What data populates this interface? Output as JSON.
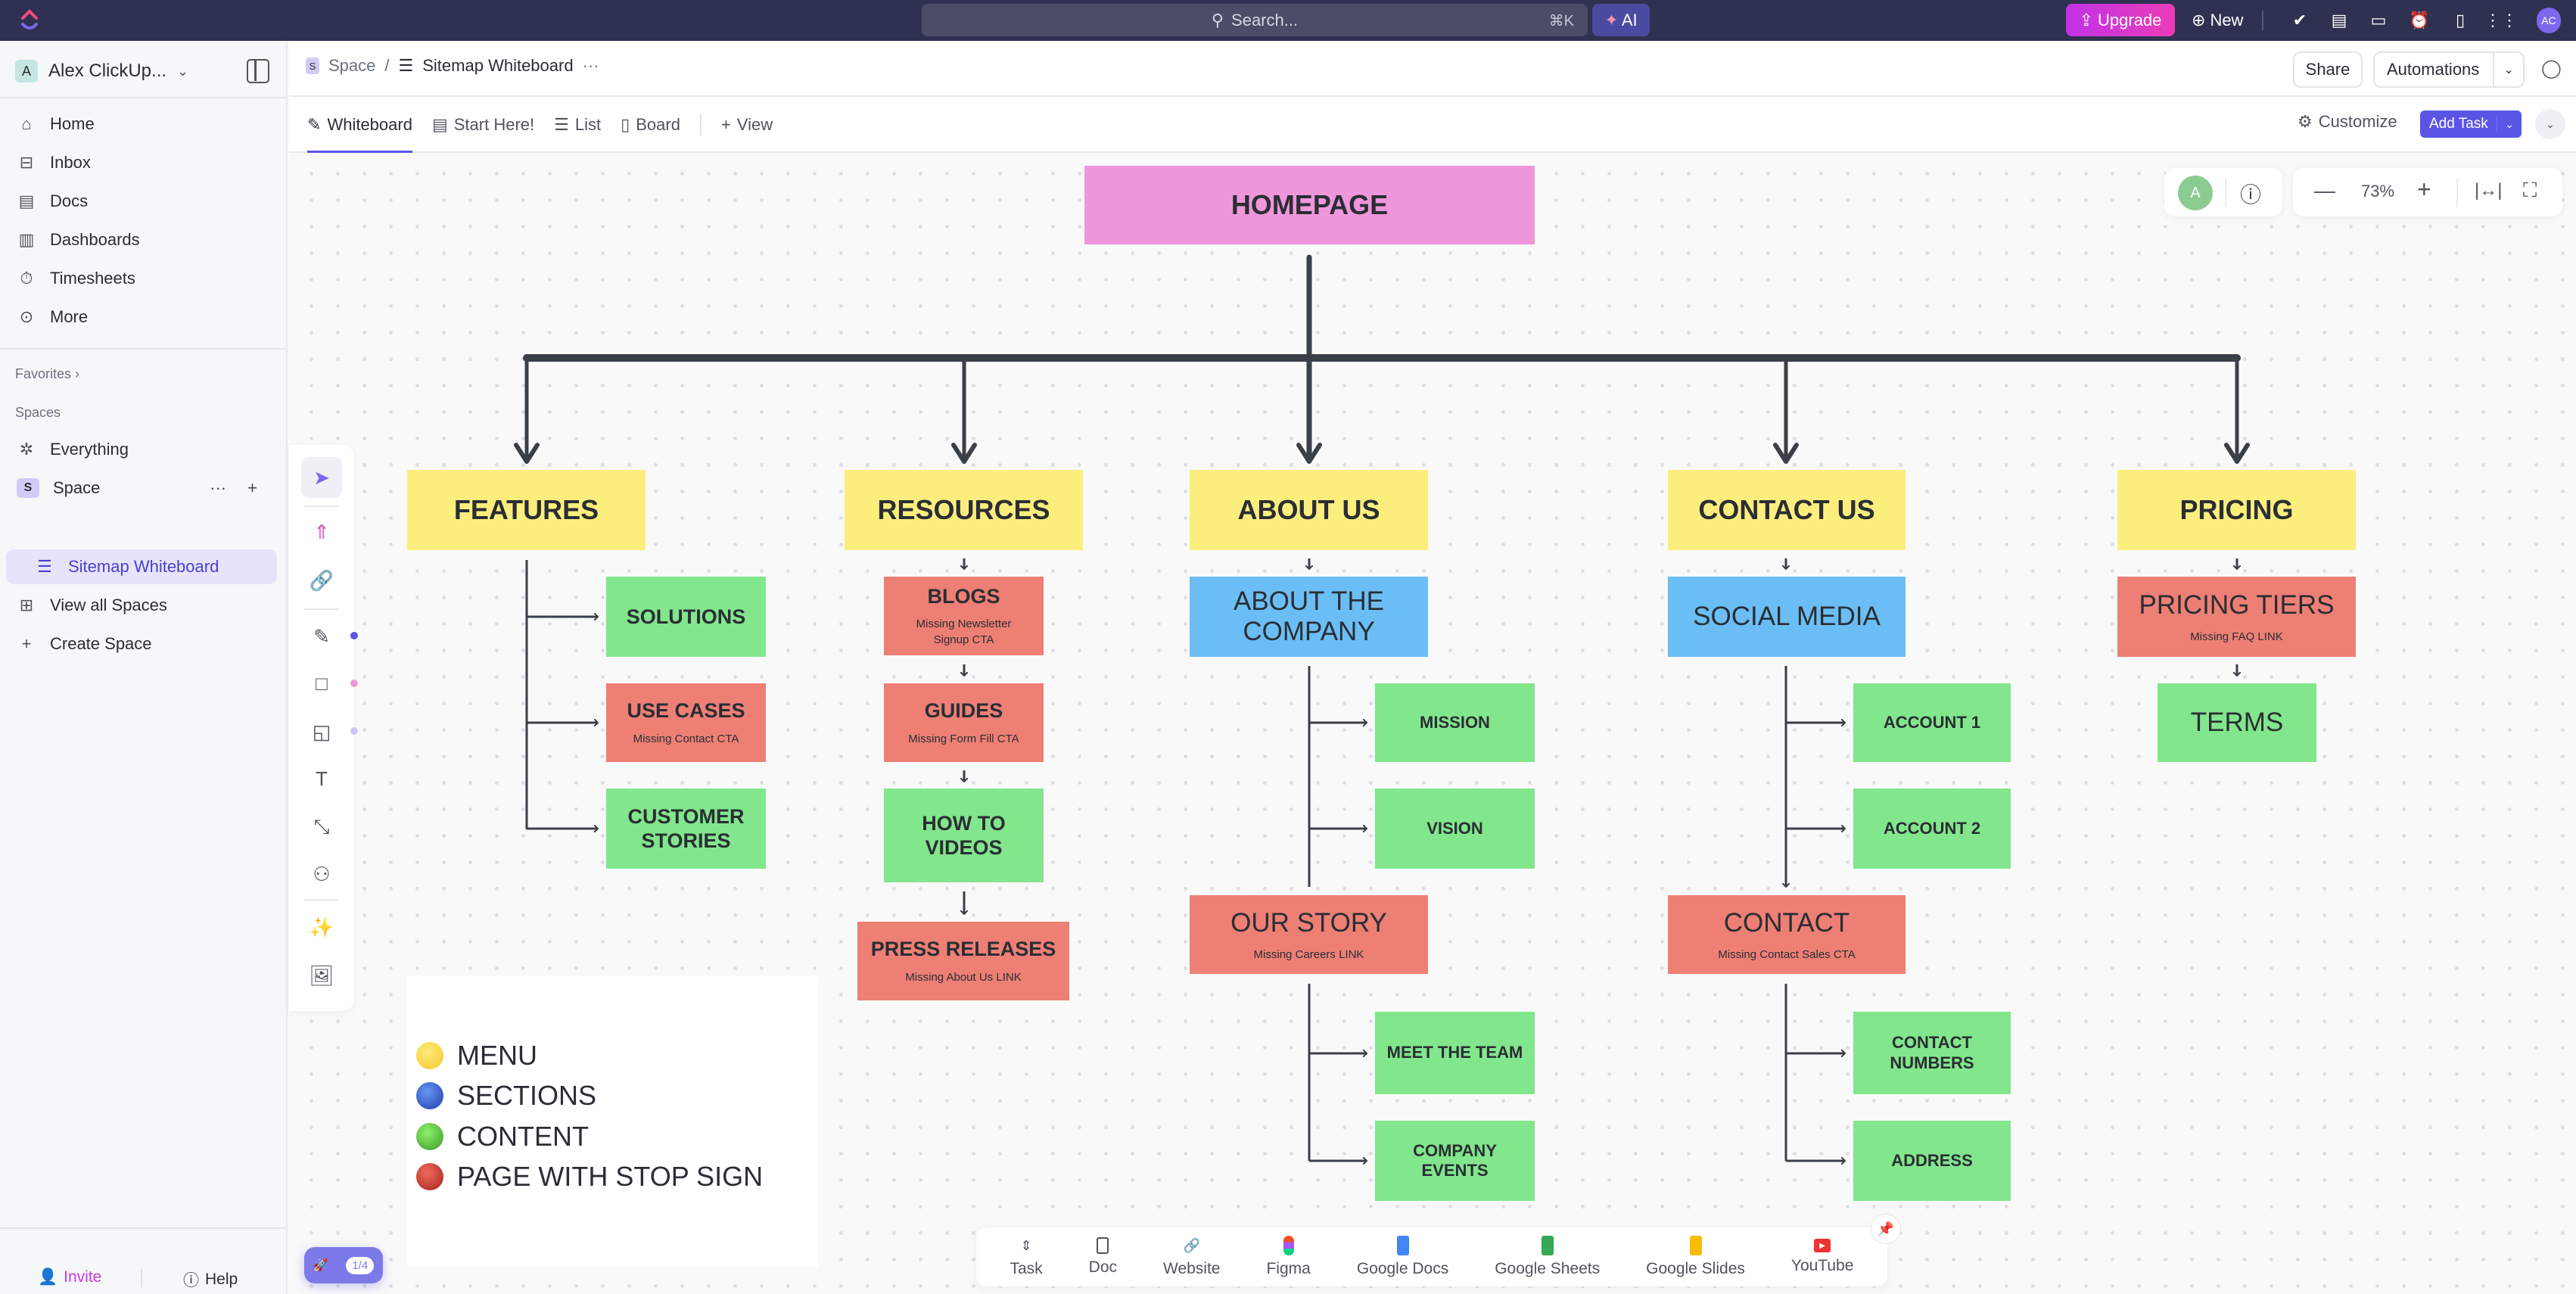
{
  "topbar": {
    "search_placeholder": "Search...",
    "search_shortcut": "⌘K",
    "ai_label": "AI",
    "upgrade_label": "Upgrade",
    "new_label": "New",
    "avatar_initials": "AC"
  },
  "sidebar": {
    "workspace_initial": "A",
    "workspace_name": "Alex ClickUp...",
    "nav": [
      {
        "label": "Home",
        "icon": "home-icon"
      },
      {
        "label": "Inbox",
        "icon": "inbox-icon"
      },
      {
        "label": "Docs",
        "icon": "docs-icon"
      },
      {
        "label": "Dashboards",
        "icon": "dashboards-icon"
      },
      {
        "label": "Timesheets",
        "icon": "timesheets-icon"
      },
      {
        "label": "More",
        "icon": "more-icon"
      }
    ],
    "favorites_label": "Favorites",
    "spaces_label": "Spaces",
    "everything_label": "Everything",
    "space_initial": "S",
    "space_label": "Space",
    "active_list_label": "Sitemap Whiteboard",
    "view_all_label": "View all Spaces",
    "create_space_label": "Create Space",
    "invite_label": "Invite",
    "help_label": "Help"
  },
  "header": {
    "breadcrumb": {
      "space_initial": "S",
      "space": "Space",
      "separator": "/",
      "page": "Sitemap Whiteboard",
      "more": "···"
    },
    "share_label": "Share",
    "automations_label": "Automations",
    "tabs": [
      {
        "label": "Whiteboard",
        "active": true
      },
      {
        "label": "Start Here!",
        "active": false
      },
      {
        "label": "List",
        "active": false
      },
      {
        "label": "Board",
        "active": false
      }
    ],
    "add_view_label": "View",
    "customize_label": "Customize",
    "add_task_label": "Add Task"
  },
  "canvas": {
    "collaborator_initial": "A",
    "zoom_level": "73%",
    "nodes": {
      "homepage": {
        "title": "HOMEPAGE"
      },
      "features": {
        "title": "FEATURES"
      },
      "resources": {
        "title": "RESOURCES"
      },
      "about_us": {
        "title": "ABOUT US"
      },
      "contact_us": {
        "title": "CONTACT US"
      },
      "pricing": {
        "title": "PRICING"
      },
      "solutions": {
        "title": "SOLUTIONS"
      },
      "use_cases": {
        "title": "USE CASES",
        "note": "Missing Contact CTA"
      },
      "customer_stories": {
        "title": "CUSTOMER STORIES"
      },
      "blogs": {
        "title": "BLOGS",
        "note": "Missing Newsletter Signup CTA"
      },
      "guides": {
        "title": "GUIDES",
        "note": "Missing Form Fill CTA"
      },
      "how_to_videos": {
        "title": "HOW TO VIDEOS"
      },
      "press_releases": {
        "title": "PRESS RELEASES",
        "note": "Missing About Us LINK"
      },
      "about_the_company": {
        "title": "ABOUT THE COMPANY"
      },
      "mission": {
        "title": "MISSION"
      },
      "vision": {
        "title": "VISION"
      },
      "our_story": {
        "title": "OUR STORY",
        "note": "Missing Careers LINK"
      },
      "meet_the_team": {
        "title": "MEET THE TEAM"
      },
      "company_events": {
        "title": "COMPANY EVENTS"
      },
      "social_media": {
        "title": "SOCIAL MEDIA"
      },
      "account_1": {
        "title": "ACCOUNT 1"
      },
      "account_2": {
        "title": "ACCOUNT 2"
      },
      "contact": {
        "title": "CONTACT",
        "note": "Missing Contact Sales CTA"
      },
      "contact_numbers": {
        "title": "CONTACT NUMBERS"
      },
      "address": {
        "title": "ADDRESS"
      },
      "pricing_tiers": {
        "title": "PRICING TIERS",
        "note": "Missing FAQ LINK"
      },
      "terms": {
        "title": "TERMS"
      }
    },
    "legend": [
      {
        "label": "MENU",
        "color": "#f5d13c"
      },
      {
        "label": "SECTIONS",
        "color": "#1f4fc4"
      },
      {
        "label": "CONTENT",
        "color": "#4cb83a"
      },
      {
        "label": "PAGE WITH STOP SIGN",
        "color": "#c4291f"
      }
    ],
    "onboarding_progress": "1/4"
  },
  "colors": {
    "menu": "#fcee7c",
    "homepage": "#f096da",
    "content": "#82e68c",
    "stop": "#ee7f75",
    "section": "#6bbef5",
    "accent": "#5b55e6"
  },
  "dock": {
    "items": [
      {
        "label": "Task"
      },
      {
        "label": "Doc"
      },
      {
        "label": "Website"
      },
      {
        "label": "Figma"
      },
      {
        "label": "Google Docs"
      },
      {
        "label": "Google Sheets"
      },
      {
        "label": "Google Slides"
      },
      {
        "label": "YouTube"
      }
    ]
  }
}
